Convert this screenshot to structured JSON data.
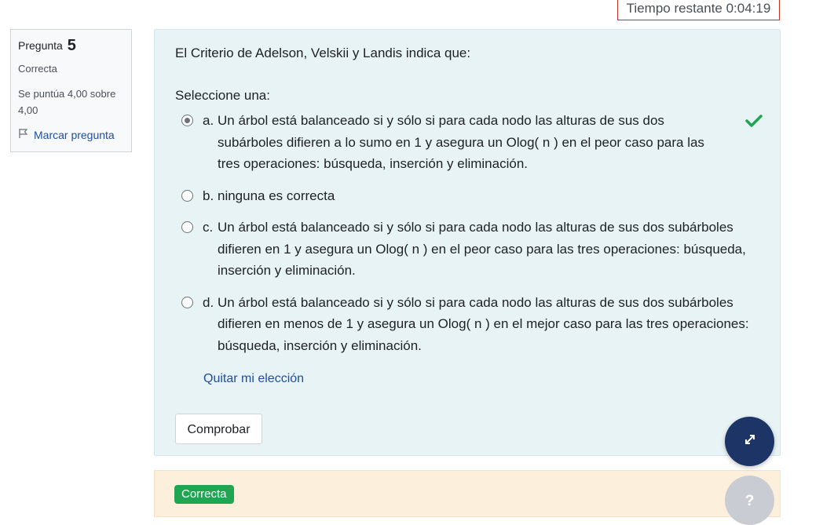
{
  "timer": {
    "label": "Tiempo restante 0:04:19"
  },
  "info": {
    "question_label": "Pregunta",
    "question_number": "5",
    "state": "Correcta",
    "grade": "Se puntúa 4,00 sobre 4,00",
    "flag_label": "Marcar pregunta"
  },
  "question": {
    "text": "El Criterio de Adelson, Velskii y Landis indica que:",
    "prompt": "Seleccione una:",
    "answers": [
      {
        "letter": "a.",
        "text": "Un árbol está balanceado si y sólo si para cada nodo las alturas de sus dos subárboles difieren a lo sumo en 1 y asegura un Olog( n ) en el peor caso para las tres operaciones: búsqueda, inserción y eliminación.",
        "selected": true,
        "correct": true
      },
      {
        "letter": "b.",
        "text": "ninguna es correcta",
        "selected": false
      },
      {
        "letter": "c.",
        "text": "Un árbol está balanceado si y sólo si para cada nodo las alturas de sus dos subárboles difieren en 1 y asegura un Olog( n ) en el peor caso para las tres operaciones: búsqueda, inserción y eliminación.",
        "selected": false
      },
      {
        "letter": "d.",
        "text": "Un árbol está balanceado si y sólo si para cada nodo las alturas de sus dos subárboles difieren en menos de 1 y asegura un Olog( n ) en el mejor caso para las tres operaciones: búsqueda, inserción y eliminación.",
        "selected": false
      }
    ],
    "clear_label": "Quitar mi elección",
    "check_button": "Comprobar"
  },
  "feedback": {
    "badge": "Correcta"
  },
  "icons": {
    "check": "check-icon",
    "flag": "flag-icon",
    "expand": "expand-icon",
    "help": "help-icon"
  },
  "colors": {
    "content_bg": "#e7f3f5",
    "feedback_bg": "#fcefdc",
    "badge": "#1ea653",
    "check": "#1ea653",
    "link": "#1f4ea0",
    "timer_border": "#ca3120",
    "fab": "#1d3466"
  }
}
